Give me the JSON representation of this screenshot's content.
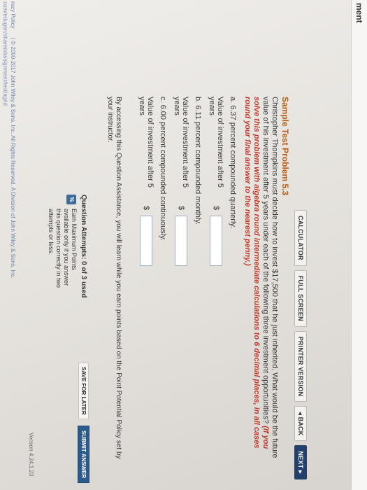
{
  "header": {
    "title": "ment"
  },
  "toolbar": {
    "calculator": "CALCULATOR",
    "full_screen": "FULL SCREEN",
    "printer_version": "PRINTER VERSION",
    "back": "◂ BACK",
    "next": "NEXT ▸"
  },
  "problem": {
    "title": "Sample Test Problem 5.3",
    "intro": "Christopher Thompkins must decide how to invest $17,500 that he just inherited. What would be the future value of his investment after 5 years under each of the following three investment opportunities?",
    "instruction": "(If you solve this problem with algebra round intermediate calculations to 6 decimal places, in all cases round your final answer to the nearest penny.)",
    "parts": [
      {
        "label": "a. 6.37 percent compounded quarterly.",
        "field_label": "Value of investment after 5 years",
        "currency": "$",
        "value": ""
      },
      {
        "label": "b. 6.11 percent compounded monthly.",
        "field_label": "Value of investment after 5 years",
        "currency": "$",
        "value": ""
      },
      {
        "label": "c. 6.00 percent compounded continuously.",
        "field_label": "Value of investment after 5 years",
        "currency": "$",
        "value": ""
      }
    ],
    "notice": "By accessing this Question Assistance, you will learn while you earn points based on the Point Potential Policy set by your instructor."
  },
  "attempts": {
    "label": "Question Attempts: 0 of 3 used",
    "icon_text": "%",
    "earn_text": "Earn Maximum Points available only if you answer this question correctly in two attempts or less.",
    "save_label": "SAVE FOR LATER",
    "submit_label": "SUBMIT ANSWER"
  },
  "footer": {
    "policy": "racy Policy",
    "copyright": "| © 2000-2017 John Wiley & Sons, Inc. All Rights Reserved. A Division of John Wiley & Sons, Inc.",
    "url": "com/edugen/shared/assignment/test/agrid",
    "version": "Version 4.24.1.23"
  },
  "colors": {
    "accent_orange": "#b85a12",
    "instruction_red": "#c0392b",
    "button_blue": "#2c5a8d"
  }
}
